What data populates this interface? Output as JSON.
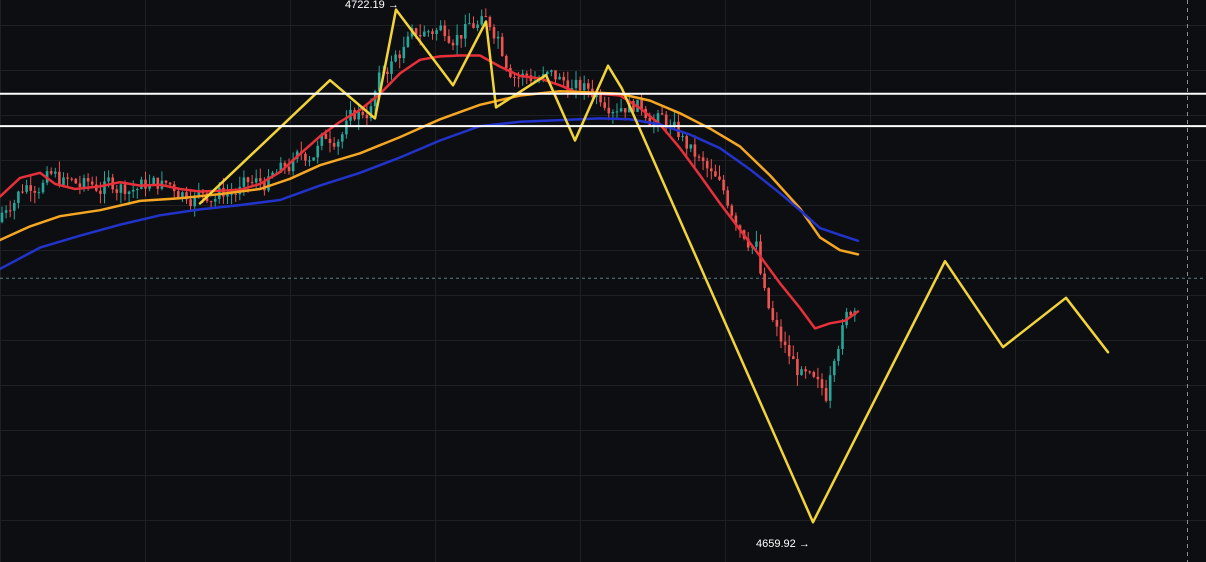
{
  "chart_data": {
    "type": "candlestick",
    "title": "",
    "xlabel": "",
    "ylabel": "",
    "ylim": [
      4655,
      4725
    ],
    "price_labels": {
      "high": {
        "text": "4722.19 →",
        "value": 4722.19
      },
      "low": {
        "text": "4659.92 →",
        "value": 4659.92
      }
    },
    "horizontal_levels": [
      4712.1,
      4708.3
    ],
    "current_price": 4690.4,
    "grid": true,
    "colors": {
      "background": "#0d0e11",
      "grid": "#1e2024",
      "up": "#26a69a",
      "down": "#ef5350",
      "ma_fast": "#e8303a",
      "ma_mid": "#f5a623",
      "ma_slow": "#2233cc",
      "pattern": "#f2d43a",
      "level": "#ffffff",
      "current": "#5a7f88"
    },
    "series": [
      {
        "key": "ma_fast",
        "points": [
          [
            0,
            4700.0
          ],
          [
            20,
            4702.2
          ],
          [
            40,
            4702.8
          ],
          [
            55,
            4701.5
          ],
          [
            75,
            4700.9
          ],
          [
            100,
            4701.2
          ],
          [
            120,
            4701.7
          ],
          [
            140,
            4701.3
          ],
          [
            160,
            4701.4
          ],
          [
            180,
            4700.9
          ],
          [
            200,
            4700.6
          ],
          [
            220,
            4700.7
          ],
          [
            240,
            4700.8
          ],
          [
            260,
            4701.5
          ],
          [
            280,
            4702.9
          ],
          [
            300,
            4705.0
          ],
          [
            320,
            4707.1
          ],
          [
            340,
            4708.8
          ],
          [
            360,
            4710.2
          ],
          [
            380,
            4712.1
          ],
          [
            400,
            4714.5
          ],
          [
            420,
            4716.1
          ],
          [
            440,
            4716.5
          ],
          [
            460,
            4716.6
          ],
          [
            480,
            4716.6
          ],
          [
            500,
            4715.3
          ],
          [
            520,
            4714.2
          ],
          [
            540,
            4713.9
          ],
          [
            560,
            4713.1
          ],
          [
            580,
            4712.1
          ],
          [
            600,
            4712.1
          ],
          [
            620,
            4711.9
          ],
          [
            640,
            4710.4
          ],
          [
            660,
            4708.5
          ],
          [
            680,
            4705.7
          ],
          [
            700,
            4702.5
          ],
          [
            720,
            4699.2
          ],
          [
            740,
            4696.1
          ],
          [
            760,
            4693.0
          ],
          [
            780,
            4689.8
          ],
          [
            800,
            4686.9
          ],
          [
            815,
            4684.5
          ],
          [
            830,
            4685.1
          ],
          [
            845,
            4685.4
          ],
          [
            858,
            4686.5
          ]
        ]
      },
      {
        "key": "ma_mid",
        "points": [
          [
            0,
            4694.9
          ],
          [
            30,
            4696.5
          ],
          [
            60,
            4697.7
          ],
          [
            100,
            4698.4
          ],
          [
            140,
            4699.5
          ],
          [
            180,
            4699.8
          ],
          [
            220,
            4700.3
          ],
          [
            260,
            4700.9
          ],
          [
            290,
            4702.1
          ],
          [
            320,
            4703.7
          ],
          [
            360,
            4705.1
          ],
          [
            400,
            4707.0
          ],
          [
            440,
            4709.1
          ],
          [
            480,
            4710.8
          ],
          [
            520,
            4711.9
          ],
          [
            560,
            4712.4
          ],
          [
            600,
            4712.2
          ],
          [
            620,
            4712.1
          ],
          [
            650,
            4711.3
          ],
          [
            680,
            4709.8
          ],
          [
            710,
            4708.0
          ],
          [
            740,
            4705.9
          ],
          [
            770,
            4702.5
          ],
          [
            800,
            4698.6
          ],
          [
            820,
            4695.2
          ],
          [
            840,
            4693.7
          ],
          [
            858,
            4693.2
          ]
        ]
      },
      {
        "key": "ma_slow",
        "points": [
          [
            0,
            4691.5
          ],
          [
            40,
            4694.0
          ],
          [
            80,
            4695.4
          ],
          [
            120,
            4696.7
          ],
          [
            160,
            4697.8
          ],
          [
            200,
            4698.5
          ],
          [
            240,
            4699.0
          ],
          [
            280,
            4699.6
          ],
          [
            320,
            4701.3
          ],
          [
            360,
            4702.8
          ],
          [
            400,
            4704.6
          ],
          [
            440,
            4706.6
          ],
          [
            480,
            4708.3
          ],
          [
            520,
            4708.8
          ],
          [
            560,
            4709.0
          ],
          [
            600,
            4709.2
          ],
          [
            630,
            4709.1
          ],
          [
            660,
            4708.5
          ],
          [
            690,
            4707.3
          ],
          [
            720,
            4705.7
          ],
          [
            750,
            4703.2
          ],
          [
            780,
            4700.4
          ],
          [
            800,
            4698.4
          ],
          [
            820,
            4696.3
          ],
          [
            840,
            4695.5
          ],
          [
            858,
            4694.8
          ]
        ]
      },
      {
        "key": "pattern",
        "points": [
          [
            200,
            4699.2
          ],
          [
            330,
            4713.7
          ],
          [
            375,
            4709.2
          ],
          [
            396,
            4722.0
          ],
          [
            453,
            4713.1
          ],
          [
            486,
            4720.6
          ],
          [
            496,
            4710.5
          ],
          [
            546,
            4714.3
          ],
          [
            575,
            4706.6
          ],
          [
            608,
            4715.4
          ],
          [
            622,
            4712.7
          ],
          [
            813,
            4661.7
          ],
          [
            945,
            4692.4
          ],
          [
            1003,
            4682.3
          ],
          [
            1066,
            4688.1
          ],
          [
            1108,
            4681.7
          ]
        ]
      }
    ]
  }
}
